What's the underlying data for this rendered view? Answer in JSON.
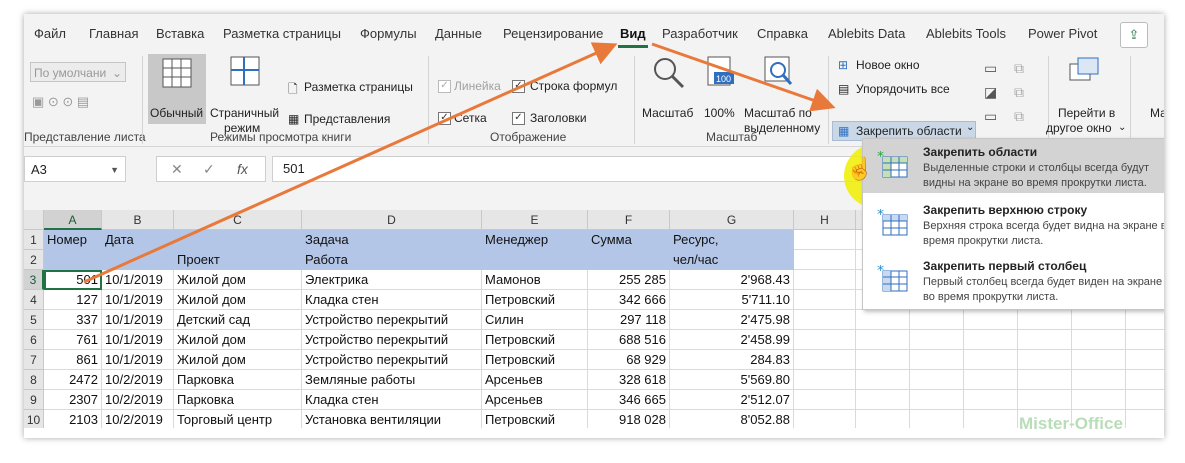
{
  "tabs": [
    "Файл",
    "Главная",
    "Вставка",
    "Разметка страницы",
    "Формулы",
    "Данные",
    "Рецензирование",
    "Вид",
    "Разработчик",
    "Справка",
    "Ablebits Data",
    "Ablebits Tools",
    "Power Pivot"
  ],
  "active_tab": "Вид",
  "ribbon": {
    "sheet_view_default": "По умолчани",
    "normal_label": "Обычный",
    "page_mode_label1": "Страничный",
    "page_mode_label2": "режим",
    "page_layout_label": "Разметка страницы",
    "custom_views_label": "Представления",
    "ruler_label": "Линейка",
    "formula_bar_label": "Строка формул",
    "gridlines_label": "Сетка",
    "headings_label": "Заголовки",
    "zoom_label": "Масштаб",
    "zoom100_label": "100%",
    "zoom_sel_label1": "Масштаб по",
    "zoom_sel_label2": "выделенному",
    "new_window_label": "Новое окно",
    "arrange_all_label": "Упорядочить все",
    "freeze_panes_label": "Закрепить области",
    "switch_window_label1": "Перейти в",
    "switch_window_label2": "другое окно",
    "macros_label": "Ма",
    "groups": {
      "sheet_view": "Представление листа",
      "workbook_views": "Режимы просмотра книги",
      "show": "Отображение",
      "zoom": "Масштаб"
    }
  },
  "formula_bar": {
    "name_box": "A3",
    "cancel": "✕",
    "enter": "✓",
    "fx": "fx",
    "value": "501"
  },
  "columns": [
    "A",
    "B",
    "C",
    "D",
    "E",
    "F",
    "G",
    "H"
  ],
  "header_rows": [
    {
      "row": "1",
      "cells": [
        "Номер",
        "Дата",
        "",
        "Задача",
        "Менеджер",
        "Сумма",
        "Ресурс,"
      ]
    },
    {
      "row": "2",
      "cells": [
        "",
        "",
        "Проект",
        "Работа",
        "",
        "",
        "чел/час"
      ]
    }
  ],
  "rows": [
    {
      "row": "3",
      "cells": [
        "501",
        "10/1/2019",
        "Жилой дом",
        "Электрика",
        "Мамонов",
        "255 285",
        "2'968.43"
      ]
    },
    {
      "row": "4",
      "cells": [
        "127",
        "10/1/2019",
        "Жилой дом",
        "Кладка стен",
        "Петровский",
        "342 666",
        "5'711.10"
      ]
    },
    {
      "row": "5",
      "cells": [
        "337",
        "10/1/2019",
        "Детский сад",
        "Устройство перекрытий",
        "Силин",
        "297 118",
        "2'475.98"
      ]
    },
    {
      "row": "6",
      "cells": [
        "761",
        "10/1/2019",
        "Жилой дом",
        "Устройство перекрытий",
        "Петровский",
        "688 516",
        "2'458.99"
      ]
    },
    {
      "row": "7",
      "cells": [
        "861",
        "10/1/2019",
        "Жилой дом",
        "Устройство перекрытий",
        "Петровский",
        "68 929",
        "284.83"
      ]
    },
    {
      "row": "8",
      "cells": [
        "2472",
        "10/2/2019",
        "Парковка",
        "Земляные работы",
        "Арсеньев",
        "328 618",
        "5'569.80"
      ]
    },
    {
      "row": "9",
      "cells": [
        "2307",
        "10/2/2019",
        "Парковка",
        "Кладка стен",
        "Арсеньев",
        "346 665",
        "2'512.07"
      ]
    },
    {
      "row": "10",
      "cells": [
        "2103",
        "10/2/2019",
        "Торговый центр",
        "Установка вентиляции",
        "Петровский",
        "918 028",
        "8'052.88"
      ]
    }
  ],
  "menu": [
    {
      "title": "Закрепить области",
      "desc": "Выделенные строки и столбцы всегда будут видны на экране во время прокрутки листа."
    },
    {
      "title": "Закрепить верхнюю строку",
      "desc": "Верхняя строка всегда будет видна на экране во время прокрутки листа."
    },
    {
      "title": "Закрепить первый столбец",
      "desc": "Первый столбец всегда будет виден на экране во время прокрутки листа."
    }
  ],
  "watermark": "Mister-Office",
  "colors": {
    "accent": "#217346",
    "header_fill": "#b4c6e7",
    "arrow": "#e8793a",
    "highlight": "#eeee00"
  }
}
